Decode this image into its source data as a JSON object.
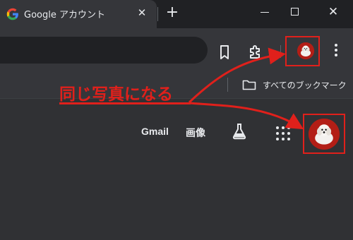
{
  "tab": {
    "title": "Google アカウント",
    "close_glyph": "✕",
    "new_tab_glyph": "+"
  },
  "window": {
    "close_glyph": "✕"
  },
  "bookmarks": {
    "folder_label": "すべてのブックマーク"
  },
  "google_bar": {
    "gmail": "Gmail",
    "images": "画像"
  },
  "annotation": {
    "text": "同じ写真になる",
    "color": "#e0201b"
  },
  "icons": {
    "tab_favicon": "google-g-icon",
    "bookmark": "bookmark-star-icon",
    "extensions": "puzzle-piece-icon",
    "menu": "vertical-dots-icon",
    "folder": "folder-icon",
    "labs": "flask-icon",
    "apps": "grid-dots-icon"
  }
}
